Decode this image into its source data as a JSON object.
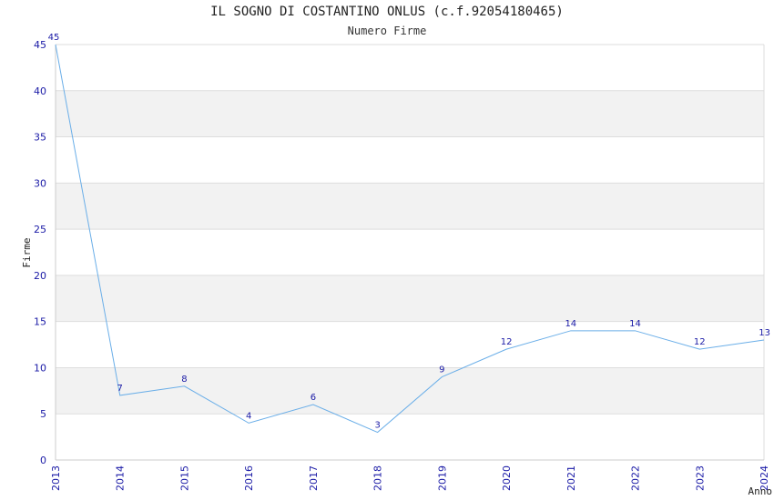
{
  "chart_data": {
    "type": "line",
    "title": "IL SOGNO DI COSTANTINO ONLUS (c.f.92054180465)",
    "subtitle": "Numero Firme",
    "xlabel": "Anno",
    "ylabel": "Firme",
    "x": [
      "2013",
      "2014",
      "2015",
      "2016",
      "2017",
      "2018",
      "2019",
      "2020",
      "2021",
      "2022",
      "2023",
      "2024"
    ],
    "series": [
      {
        "values": [
          45,
          7,
          8,
          4,
          6,
          3,
          9,
          12,
          14,
          14,
          12,
          13
        ]
      }
    ],
    "ylim": [
      0,
      45
    ],
    "yticks": [
      0,
      5,
      10,
      15,
      20,
      25,
      30,
      35,
      40,
      45
    ],
    "grid": true,
    "colors": {
      "line": "#6aaee8",
      "labels": "#1a1aa6",
      "band": "#f2f2f2"
    }
  }
}
